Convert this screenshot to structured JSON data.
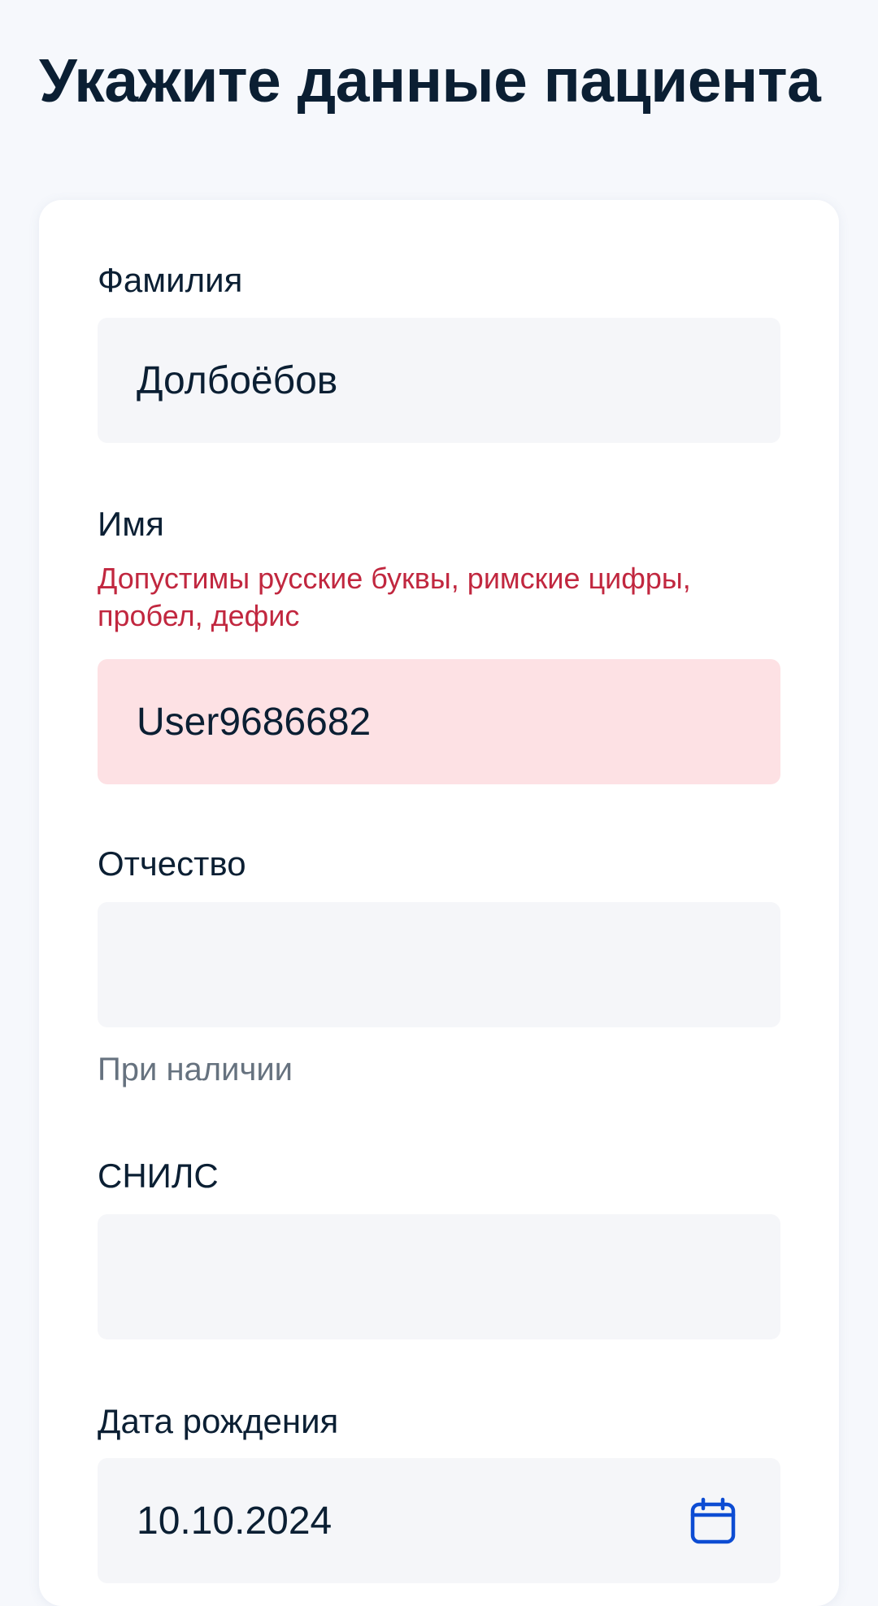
{
  "page": {
    "title": "Укажите данные пациента"
  },
  "form": {
    "last_name": {
      "label": "Фамилия",
      "value": "Долбоёбов"
    },
    "first_name": {
      "label": "Имя",
      "error": "Допустимы русские буквы, римские цифры, пробел, дефис",
      "value": "User9686682"
    },
    "middle_name": {
      "label": "Отчество",
      "value": "",
      "hint": "При наличии"
    },
    "snils": {
      "label": "СНИЛС",
      "value": ""
    },
    "birth_date": {
      "label": "Дата рождения",
      "value": "10.10.2024",
      "icon": "calendar-icon"
    }
  },
  "colors": {
    "error_text": "#c1273f",
    "error_field_bg": "#fde1e4",
    "field_bg": "#f5f6f9",
    "icon_accent": "#0d4cd3",
    "page_bg": "#f6f8fc"
  }
}
